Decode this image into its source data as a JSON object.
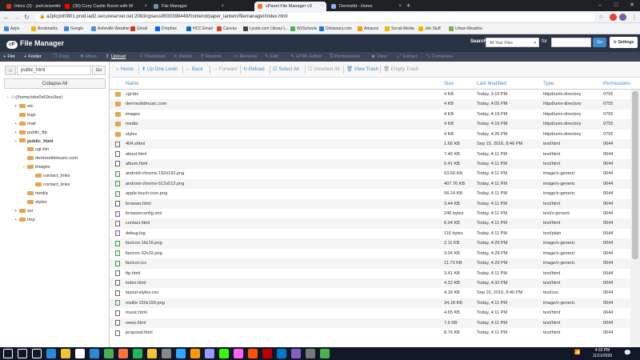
{
  "browser": {
    "tabs": [
      {
        "title": "Inbox (2) - josh.leisenring@gmail",
        "favicon": "gmail-icon",
        "color": "#d93025"
      },
      {
        "title": "(30) Cozy Castle Room with W",
        "favicon": "youtube-icon",
        "color": "#ff0000"
      },
      {
        "title": "File Manager",
        "favicon": "globe-icon",
        "color": "#5f9ea0"
      },
      {
        "title": "cPanel File Manager v3",
        "favicon": "cpanel-icon",
        "color": "#ff6c2c",
        "active": true
      },
      {
        "title": "Dermstid - Home",
        "favicon": "globe-icon",
        "color": "#8ab4f8"
      }
    ],
    "new_tab_label": "+",
    "url": "a2plcpnl0801.prod.iad2.secureserver.net:2083/cpsess9930398449/frontend/paper_lantern/filemanager/index.html",
    "bookmarks": [
      {
        "label": "Apps",
        "color": "#4285f4"
      },
      {
        "label": "Bookmarks",
        "color": "#f4b400"
      },
      {
        "label": "Google",
        "color": "#4285f4"
      },
      {
        "label": "Asheville Weather",
        "color": "#4a90d9"
      },
      {
        "label": "Gmail",
        "color": "#d93025"
      },
      {
        "label": "Dropbox",
        "color": "#0061ff"
      },
      {
        "label": "HCC Email",
        "color": "#0072c6"
      },
      {
        "label": "Canvas",
        "color": "#e13f2b"
      },
      {
        "label": "Lynda.com Library L...",
        "color": "#444"
      },
      {
        "label": "W3Schools",
        "color": "#4caf50"
      },
      {
        "label": "Dictionary.com",
        "color": "#1a73e8"
      },
      {
        "label": "Amazon",
        "color": "#ff9900"
      },
      {
        "label": "Social Media",
        "color": "#f4b400"
      },
      {
        "label": "Job Stuff",
        "color": "#f4b400"
      },
      {
        "label": "Urban Meadow",
        "color": "#7cb342"
      }
    ]
  },
  "header": {
    "app_title": "File Manager",
    "logo_text": "cP",
    "search_label": "Search",
    "search_scope": "All Your Files",
    "for_label": "for",
    "search_value": "",
    "go_label": "Go",
    "settings_label": "Settings"
  },
  "toolbar": [
    {
      "label": "File",
      "icon": "+",
      "name": "new-file-button",
      "enabled": true
    },
    {
      "label": "Folder",
      "icon": "+",
      "name": "new-folder-button",
      "enabled": true
    },
    {
      "label": "Copy",
      "icon": "❐",
      "name": "copy-button",
      "enabled": false
    },
    {
      "label": "Move",
      "icon": "✥",
      "name": "move-button",
      "enabled": false
    },
    {
      "label": "Upload",
      "icon": "⇧",
      "name": "upload-button",
      "enabled": true
    },
    {
      "label": "Download",
      "icon": "⇩",
      "name": "download-button",
      "enabled": false
    },
    {
      "label": "Delete",
      "icon": "✕",
      "name": "delete-button",
      "enabled": false
    },
    {
      "label": "Restore",
      "icon": "↺",
      "name": "restore-button",
      "enabled": false
    },
    {
      "label": "Rename",
      "icon": "▭",
      "name": "rename-button",
      "enabled": false
    },
    {
      "label": "Edit",
      "icon": "✎",
      "name": "edit-button",
      "enabled": false
    },
    {
      "label": "HTML Editor",
      "icon": "✎",
      "name": "html-editor-button",
      "enabled": false
    },
    {
      "label": "Permissions",
      "icon": "⚿",
      "name": "permissions-button",
      "enabled": false
    },
    {
      "label": "View",
      "icon": "◉",
      "name": "view-button",
      "enabled": false
    },
    {
      "label": "Extract",
      "icon": "⤢",
      "name": "extract-button",
      "enabled": false
    },
    {
      "label": "Compress",
      "icon": "⤡",
      "name": "compress-button",
      "enabled": false
    }
  ],
  "left": {
    "path_value": "public_html",
    "go_label": "Go",
    "collapse_label": "Collapse All",
    "tree": [
      {
        "label": "(/home/obs0s69xo3ee)",
        "depth": 0,
        "exp": "–",
        "home": true
      },
      {
        "label": "etc",
        "depth": 1,
        "exp": "+"
      },
      {
        "label": "logs",
        "depth": 1,
        "exp": ""
      },
      {
        "label": "mail",
        "depth": 1,
        "exp": "+"
      },
      {
        "label": "public_ftp",
        "depth": 1,
        "exp": "+"
      },
      {
        "label": "public_html",
        "depth": 1,
        "exp": "–",
        "bold": true
      },
      {
        "label": "cgi-bin",
        "depth": 2,
        "exp": ""
      },
      {
        "label": "dermestidmusic.com",
        "depth": 2,
        "exp": ""
      },
      {
        "label": "images",
        "depth": 2,
        "exp": "–"
      },
      {
        "label": "contact_links",
        "depth": 3,
        "exp": ""
      },
      {
        "label": "contact_links",
        "depth": 3,
        "exp": ""
      },
      {
        "label": "media",
        "depth": 2,
        "exp": ""
      },
      {
        "label": "styles",
        "depth": 2,
        "exp": ""
      },
      {
        "label": "ssl",
        "depth": 1,
        "exp": "+"
      },
      {
        "label": "tmp",
        "depth": 1,
        "exp": "+"
      }
    ]
  },
  "actions": [
    {
      "label": "Home",
      "icon": "⌂",
      "name": "home-action",
      "enabled": true
    },
    {
      "label": "Up One Level",
      "icon": "⬆",
      "name": "up-one-level-action",
      "enabled": true
    },
    {
      "label": "Back",
      "icon": "←",
      "name": "back-action",
      "enabled": true
    },
    {
      "label": "Forward",
      "icon": "→",
      "name": "forward-action",
      "enabled": false
    },
    {
      "label": "Reload",
      "icon": "↻",
      "name": "reload-action",
      "enabled": true
    },
    {
      "label": "Select All",
      "icon": "☑",
      "name": "select-all-action",
      "enabled": true
    },
    {
      "label": "Unselect All",
      "icon": "☐",
      "name": "unselect-all-action",
      "enabled": false
    },
    {
      "label": "View Trash",
      "icon": "🗑",
      "name": "view-trash-action",
      "enabled": true
    },
    {
      "label": "Empty Trash",
      "icon": "🗑",
      "name": "empty-trash-action",
      "enabled": false
    }
  ],
  "columns": [
    "Name",
    "Size",
    "Last Modified",
    "Type",
    "Permissions"
  ],
  "files": [
    {
      "name": "cgi-bin",
      "size": "4 KB",
      "modified": "Today, 3:10 PM",
      "type": "httpd/unix-directory",
      "perm": "0755",
      "icon": "folder"
    },
    {
      "name": "dermestidmusic.com",
      "size": "4 KB",
      "modified": "Today, 4:05 PM",
      "type": "httpd/unix-directory",
      "perm": "0755",
      "icon": "folder"
    },
    {
      "name": "images",
      "size": "4 KB",
      "modified": "Today, 4:19 PM",
      "type": "httpd/unix-directory",
      "perm": "0755",
      "icon": "folder"
    },
    {
      "name": "media",
      "size": "4 KB",
      "modified": "Today, 4:16 PM",
      "type": "httpd/unix-directory",
      "perm": "0755",
      "icon": "folder"
    },
    {
      "name": "styles",
      "size": "4 KB",
      "modified": "Today, 4:26 PM",
      "type": "httpd/unix-directory",
      "perm": "0755",
      "icon": "folder"
    },
    {
      "name": "404.shtml",
      "size": "1.66 KB",
      "modified": "Sep 15, 2016, 8:46 PM",
      "type": "text/html",
      "perm": "0644",
      "icon": "file"
    },
    {
      "name": "about.html",
      "size": "7.46 KB",
      "modified": "Today, 4:11 PM",
      "type": "text/html",
      "perm": "0644",
      "icon": "file"
    },
    {
      "name": "album.html",
      "size": "6.41 KB",
      "modified": "Today, 4:11 PM",
      "type": "text/html",
      "perm": "0644",
      "icon": "file"
    },
    {
      "name": "android-chrome-192x192.png",
      "size": "63.69 KB",
      "modified": "Today, 4:11 PM",
      "type": "image/x-generic",
      "perm": "0644",
      "icon": "img"
    },
    {
      "name": "android-chrome-512x512.png",
      "size": "407.76 KB",
      "modified": "Today, 4:11 PM",
      "type": "image/x-generic",
      "perm": "0644",
      "icon": "img"
    },
    {
      "name": "apple-touch-icon.png",
      "size": "56.24 KB",
      "modified": "Today, 4:11 PM",
      "type": "image/x-generic",
      "perm": "0644",
      "icon": "img"
    },
    {
      "name": "browser.html",
      "size": "3.44 KB",
      "modified": "Today, 4:11 PM",
      "type": "text/html",
      "perm": "0644",
      "icon": "file"
    },
    {
      "name": "browserconfig.xml",
      "size": "246 bytes",
      "modified": "Today, 4:11 PM",
      "type": "text/x-generic",
      "perm": "0644",
      "icon": "xml"
    },
    {
      "name": "contact.html",
      "size": "6.94 KB",
      "modified": "Today, 4:11 PM",
      "type": "text/html",
      "perm": "0644",
      "icon": "file"
    },
    {
      "name": "debug.log",
      "size": "116 bytes",
      "modified": "Today, 4:11 PM",
      "type": "text/plain",
      "perm": "0644",
      "icon": "txt"
    },
    {
      "name": "favicon-16x16.png",
      "size": "2.11 KB",
      "modified": "Today, 4:29 PM",
      "type": "image/x-generic",
      "perm": "0644",
      "icon": "img"
    },
    {
      "name": "favicon-32x32.png",
      "size": "3.04 KB",
      "modified": "Today, 4:29 PM",
      "type": "image/x-generic",
      "perm": "0644",
      "icon": "img"
    },
    {
      "name": "favicon.ico",
      "size": "11.73 KB",
      "modified": "Today, 4:29 PM",
      "type": "image/x-generic",
      "perm": "0644",
      "icon": "img"
    },
    {
      "name": "ftp.html",
      "size": "3.41 KB",
      "modified": "Today, 4:11 PM",
      "type": "text/html",
      "perm": "0644",
      "icon": "file"
    },
    {
      "name": "index.html",
      "size": "4.22 KB",
      "modified": "Today, 4:32 PM",
      "type": "text/html",
      "perm": "0644",
      "icon": "file"
    },
    {
      "name": "layout-styles.css",
      "size": "4.16 KB",
      "modified": "Sep 15, 2016, 8:46 PM",
      "type": "text/css",
      "perm": "0644",
      "icon": "file"
    },
    {
      "name": "mstile-150x150.png",
      "size": "34.18 KB",
      "modified": "Today, 4:11 PM",
      "type": "image/x-generic",
      "perm": "0644",
      "icon": "img"
    },
    {
      "name": "music.html",
      "size": "4.65 KB",
      "modified": "Today, 4:11 PM",
      "type": "text/html",
      "perm": "0644",
      "icon": "file"
    },
    {
      "name": "news.html",
      "size": "7.6 KB",
      "modified": "Today, 4:11 PM",
      "type": "text/html",
      "perm": "0644",
      "icon": "file"
    },
    {
      "name": "proposal.html",
      "size": "8.76 KB",
      "modified": "Today, 4:11 PM",
      "type": "text/html",
      "perm": "0644",
      "icon": "file"
    }
  ],
  "taskbar": {
    "time": "4:33 PM",
    "date": "11/11/2020",
    "apps": [
      {
        "name": "start-icon",
        "color": "#fff"
      },
      {
        "name": "search-icon",
        "color": "#fff"
      },
      {
        "name": "task-view-icon",
        "color": "#fff"
      },
      {
        "name": "edge-icon",
        "color": "#2b88d8"
      },
      {
        "name": "file-explorer-icon",
        "color": "#f4c430"
      },
      {
        "name": "store-icon",
        "color": "#fff"
      },
      {
        "name": "mail-icon",
        "color": "#2b88d8"
      },
      {
        "name": "chrome-icon",
        "color": "#4caf50"
      },
      {
        "name": "firefox-icon",
        "color": "#ff7139"
      },
      {
        "name": "spotify-icon",
        "color": "#1db954"
      },
      {
        "name": "files-icon",
        "color": "#f4c430"
      },
      {
        "name": "app-icon",
        "color": "#888"
      },
      {
        "name": "photoshop-icon",
        "color": "#31a8ff"
      },
      {
        "name": "illustrator-icon",
        "color": "#ff9a00"
      },
      {
        "name": "premiere-icon",
        "color": "#9999ff"
      },
      {
        "name": "dreamweaver-icon",
        "color": "#35fa00"
      },
      {
        "name": "xd-icon",
        "color": "#ff61f6"
      },
      {
        "name": "animate-icon",
        "color": "#ff4f00"
      },
      {
        "name": "filezilla-icon",
        "color": "#bf0000"
      },
      {
        "name": "vscode-icon",
        "color": "#007acc"
      },
      {
        "name": "visualstudio-icon",
        "color": "#865fc5"
      },
      {
        "name": "app2-icon",
        "color": "#777"
      },
      {
        "name": "app3-icon",
        "color": "#4caf50"
      }
    ]
  }
}
